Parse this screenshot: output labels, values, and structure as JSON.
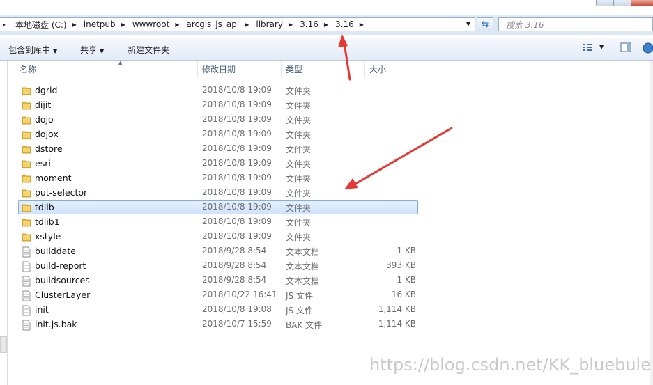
{
  "address": {
    "segments": [
      "本地磁盘 (C:)",
      "inetpub",
      "wwwroot",
      "arcgis_js_api",
      "library",
      "3.16",
      "3.16"
    ]
  },
  "search": {
    "placeholder": "搜索 3.16"
  },
  "toolbar": {
    "include_library": "包含到库中",
    "share": "共享",
    "new_folder": "新建文件夹"
  },
  "columns": {
    "name": "名称",
    "modified": "修改日期",
    "type": "类型",
    "size": "大小"
  },
  "files": [
    {
      "name": "dgrid",
      "date": "2018/10/8 19:09",
      "type": "文件夹",
      "size": "",
      "kind": "folder"
    },
    {
      "name": "dijit",
      "date": "2018/10/8 19:09",
      "type": "文件夹",
      "size": "",
      "kind": "folder"
    },
    {
      "name": "dojo",
      "date": "2018/10/8 19:09",
      "type": "文件夹",
      "size": "",
      "kind": "folder"
    },
    {
      "name": "dojox",
      "date": "2018/10/8 19:09",
      "type": "文件夹",
      "size": "",
      "kind": "folder"
    },
    {
      "name": "dstore",
      "date": "2018/10/8 19:09",
      "type": "文件夹",
      "size": "",
      "kind": "folder"
    },
    {
      "name": "esri",
      "date": "2018/10/8 19:09",
      "type": "文件夹",
      "size": "",
      "kind": "folder"
    },
    {
      "name": "moment",
      "date": "2018/10/8 19:09",
      "type": "文件夹",
      "size": "",
      "kind": "folder"
    },
    {
      "name": "put-selector",
      "date": "2018/10/8 19:09",
      "type": "文件夹",
      "size": "",
      "kind": "folder"
    },
    {
      "name": "tdlib",
      "date": "2018/10/8 19:09",
      "type": "文件夹",
      "size": "",
      "kind": "folder",
      "selected": true
    },
    {
      "name": "tdlib1",
      "date": "2018/10/8 19:09",
      "type": "文件夹",
      "size": "",
      "kind": "folder"
    },
    {
      "name": "xstyle",
      "date": "2018/10/8 19:09",
      "type": "文件夹",
      "size": "",
      "kind": "folder"
    },
    {
      "name": "builddate",
      "date": "2018/9/28 8:54",
      "type": "文本文档",
      "size": "1 KB",
      "kind": "file"
    },
    {
      "name": "build-report",
      "date": "2018/9/28 8:54",
      "type": "文本文档",
      "size": "393 KB",
      "kind": "file"
    },
    {
      "name": "buildsources",
      "date": "2018/9/28 8:54",
      "type": "文本文档",
      "size": "1 KB",
      "kind": "file"
    },
    {
      "name": "ClusterLayer",
      "date": "2018/10/22 16:41",
      "type": "JS 文件",
      "size": "16 KB",
      "kind": "file"
    },
    {
      "name": "init",
      "date": "2018/10/8 19:08",
      "type": "JS 文件",
      "size": "1,114 KB",
      "kind": "file"
    },
    {
      "name": "init.js.bak",
      "date": "2018/10/7 15:59",
      "type": "BAK 文件",
      "size": "1,114 KB",
      "kind": "file"
    }
  ],
  "watermark": "https://blog.csdn.net/KK_bluebule",
  "colors": {
    "selection_bg": "#cfe3fb",
    "selection_border": "#84acdd",
    "annotation_arrow": "#e53935",
    "folder": "#e8b93d"
  }
}
